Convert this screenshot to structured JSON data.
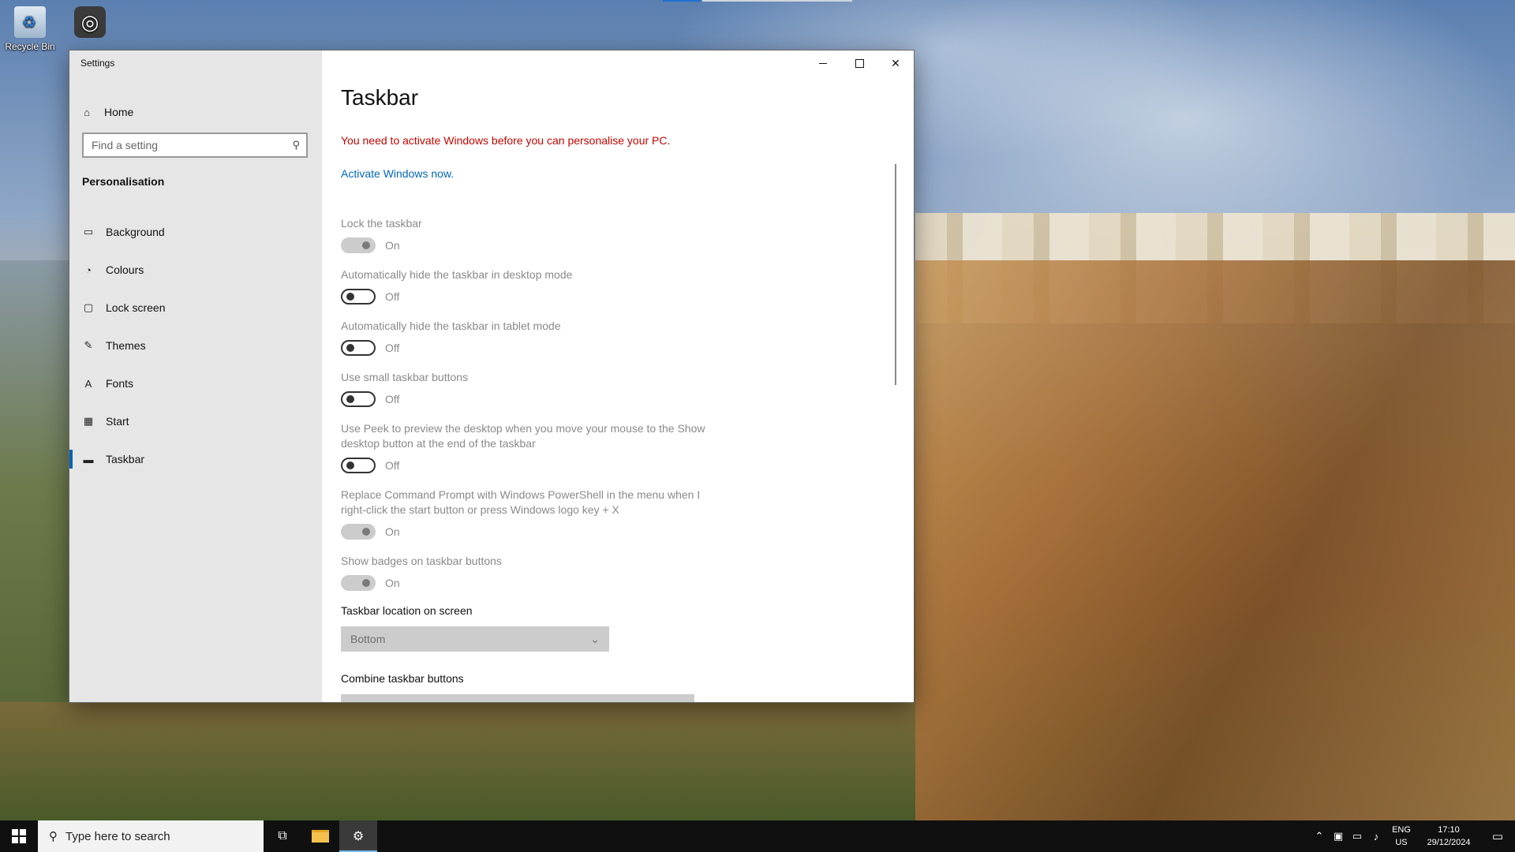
{
  "desktop": {
    "icons": [
      {
        "label": "Recycle Bin"
      },
      {
        "label": ""
      }
    ]
  },
  "window": {
    "title": "Settings",
    "controls": {
      "minimize": "—",
      "maximize": "☐",
      "close": "✕"
    }
  },
  "sidebar": {
    "home_label": "Home",
    "search_placeholder": "Find a setting",
    "section_title": "Personalisation",
    "items": [
      {
        "label": "Background",
        "icon": "picture-icon"
      },
      {
        "label": "Colours",
        "icon": "palette-icon"
      },
      {
        "label": "Lock screen",
        "icon": "lock-screen-icon"
      },
      {
        "label": "Themes",
        "icon": "brush-icon"
      },
      {
        "label": "Fonts",
        "icon": "font-icon"
      },
      {
        "label": "Start",
        "icon": "start-tiles-icon"
      },
      {
        "label": "Taskbar",
        "icon": "taskbar-icon"
      }
    ],
    "active_index": 6
  },
  "main": {
    "title": "Taskbar",
    "warning": "You need to activate Windows before you can personalise your PC.",
    "activate_link": "Activate Windows now.",
    "settings": [
      {
        "label": "Lock the taskbar",
        "state": "On"
      },
      {
        "label": "Automatically hide the taskbar in desktop mode",
        "state": "Off"
      },
      {
        "label": "Automatically hide the taskbar in tablet mode",
        "state": "Off"
      },
      {
        "label": "Use small taskbar buttons",
        "state": "Off"
      },
      {
        "label": "Use Peek to preview the desktop when you move your mouse to the Show desktop button at the end of the taskbar",
        "state": "Off"
      },
      {
        "label": "Replace Command Prompt with Windows PowerShell in the menu when I right-click the start button or press Windows logo key + X",
        "state": "On"
      },
      {
        "label": "Show badges on taskbar buttons",
        "state": "On"
      }
    ],
    "location_label": "Taskbar location on screen",
    "location_value": "Bottom",
    "combine_label": "Combine taskbar buttons"
  },
  "taskbar": {
    "search_placeholder": "Type here to search",
    "lang_top": "ENG",
    "lang_bottom": "US",
    "time": "17:10",
    "date": "29/12/2024"
  },
  "colors": {
    "accent": "#0063b1",
    "warning": "#c50500",
    "link": "#0067b8"
  }
}
